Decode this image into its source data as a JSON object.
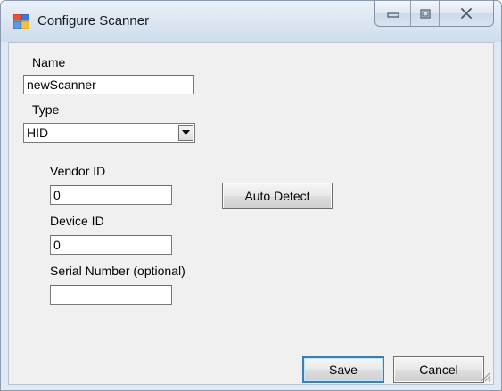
{
  "window": {
    "title": "Configure Scanner",
    "icons": {
      "app": "configure-app-icon",
      "minimize": "minimize-icon",
      "maximize": "maximize-icon",
      "close": "close-icon"
    }
  },
  "form": {
    "name_label": "Name",
    "name_value": "newScanner",
    "type_label": "Type",
    "type_value": "HID",
    "vendor_label": "Vendor ID",
    "vendor_value": "0",
    "device_label": "Device ID",
    "device_value": "0",
    "serial_label": "Serial Number (optional)",
    "serial_value": ""
  },
  "buttons": {
    "auto_detect": "Auto Detect",
    "save": "Save",
    "cancel": "Cancel"
  },
  "colors": {
    "accent": "#3c7fb1",
    "titlebar": "#dbe5f1",
    "client": "#f0f0f0"
  }
}
